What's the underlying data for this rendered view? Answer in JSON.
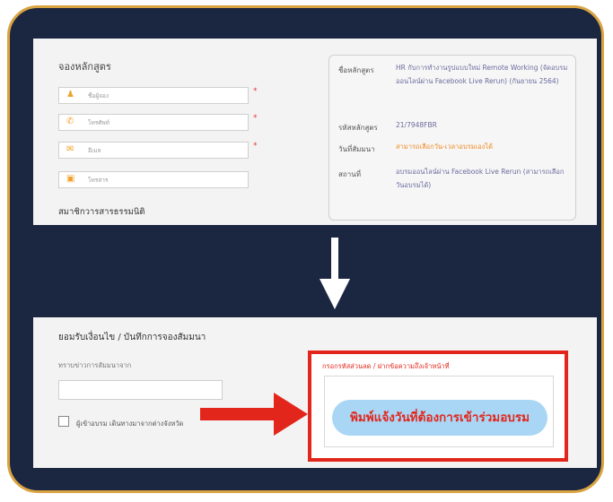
{
  "booking_form": {
    "title": "จองหลักสูตร",
    "fields": [
      {
        "icon": "user-icon",
        "placeholder": "ชื่อผู้จอง",
        "required": true
      },
      {
        "icon": "phone-icon",
        "placeholder": "โทรศัพท์",
        "required": true
      },
      {
        "icon": "email-icon",
        "placeholder": "อีเมล",
        "required": true
      },
      {
        "icon": "briefcase-icon",
        "placeholder": "โทรสาร",
        "required": false
      }
    ],
    "membership_label": "สมาชิกวารสารธรรมนิติ",
    "required_mark": "*"
  },
  "course_info": {
    "course_label": "ชื่อหลักสูตร",
    "course_value": "HR กับการทำงานรูปแบบใหม่ Remote Working (จัดอบรมออนไลน์ผ่าน Facebook Live Rerun) (กันยายน 2564)",
    "code_label": "รหัสหลักสูตร",
    "code_value": "21/7948FBR",
    "date_label": "วันที่สัมมนา",
    "date_value": "สามารถเลือกวัน-เวลาอบรมเองได้",
    "place_label": "สถานที่",
    "place_value": "อบรมออนไลน์ผ่าน Facebook Live Rerun (สามารถเลือกวันอบรมได้)"
  },
  "confirm_section": {
    "title": "ยอมรับเงื่อนไข / บันทึกการจองสัมมนา",
    "source_label": "ทราบข่าวการสัมมนาจาก",
    "checkbox_label": "ผู้เข้าอบรม เดินทางมาจากต่างจังหวัด",
    "discount_label": "กรอกรหัสส่วนลด / ฝากข้อความถึงเจ้าหน้าที่",
    "callout": "พิมพ์แจ้งวันที่ต้องการเข้าร่วมอบรม"
  },
  "colors": {
    "frame": "#1b2741",
    "border_gold": "#d9a441",
    "accent_red": "#e2261c",
    "icon_orange": "#f0a22b",
    "callout_bg": "#a9d6f5"
  }
}
